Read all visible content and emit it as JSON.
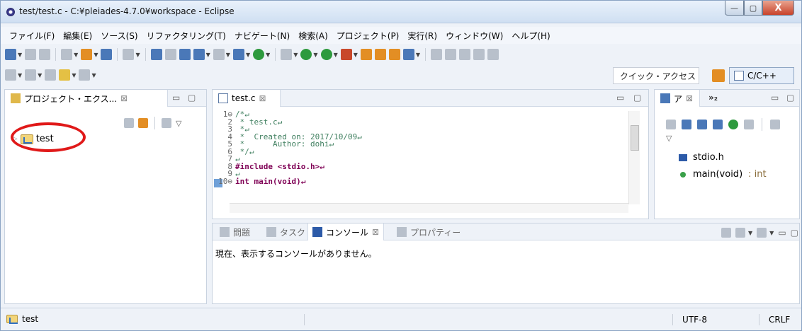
{
  "window": {
    "title": "test/test.c - C:¥pleiades-4.7.0¥workspace - Eclipse",
    "min_label": "—",
    "max_label": "▢",
    "close_label": "X"
  },
  "menubar": {
    "items": [
      "ファイル(F)",
      "編集(E)",
      "ソース(S)",
      "リファクタリング(T)",
      "ナビゲート(N)",
      "検索(A)",
      "プロジェクト(P)",
      "実行(R)",
      "ウィンドウ(W)",
      "ヘルプ(H)"
    ]
  },
  "quick_access": "クイック・アクセス",
  "perspective": "C/C++",
  "project_explorer": {
    "tab_label": "プロジェクト・エクス...",
    "close": "⊠",
    "items": [
      {
        "label": "test"
      }
    ]
  },
  "editor": {
    "tab_label": "test.c",
    "close": "⊠",
    "lines": [
      {
        "n": "1⊖",
        "text": "/*↵"
      },
      {
        "n": "2",
        "text": " * test.c↵"
      },
      {
        "n": "3",
        "text": " *↵"
      },
      {
        "n": "4",
        "text": " *  Created on: 2017/10/09↵"
      },
      {
        "n": "5",
        "text": " *      Author: dohi↵"
      },
      {
        "n": "6",
        "text": " */↵"
      },
      {
        "n": "7",
        "text": "↵"
      },
      {
        "n": "8",
        "text": "#include <stdio.h>↵"
      },
      {
        "n": "9",
        "text": "↵"
      },
      {
        "n": "10⊖",
        "text": "int main(void)↵"
      }
    ]
  },
  "outline": {
    "tab_label": "ア",
    "close": "⊠",
    "more": "»₂",
    "items": [
      {
        "label": "stdio.h",
        "type": ""
      },
      {
        "label": "main(void)",
        "type": " : int"
      }
    ]
  },
  "console_panel": {
    "tabs": [
      "問題",
      "タスク",
      "コンソール",
      "プロパティー"
    ],
    "active_close": "⊠",
    "message": "現在、表示するコンソールがありません。"
  },
  "statusbar": {
    "project": "test",
    "encoding": "UTF-8",
    "line_ending": "CRLF"
  },
  "colors": {
    "highlight_circle": "#e01919",
    "keyword": "#7f0055",
    "comment": "#3f7f5f"
  }
}
